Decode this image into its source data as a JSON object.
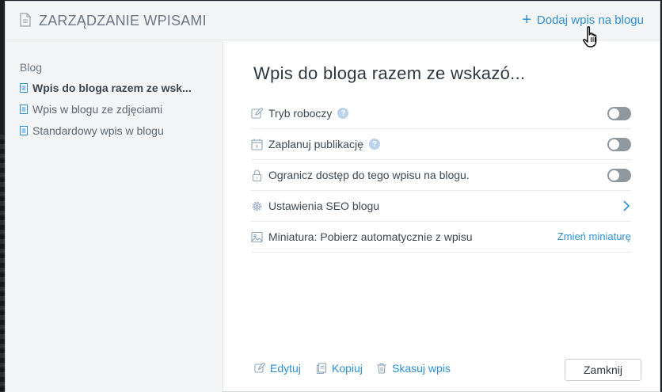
{
  "header": {
    "title": "ZARZĄDZANIE WPISAMI",
    "add_post_label": "Dodaj wpis na blogu",
    "add_post_icon": "plus-icon"
  },
  "sidebar": {
    "heading": "Blog",
    "items": [
      {
        "label": "Wpis do bloga razem ze wsk...",
        "active": true
      },
      {
        "label": "Wpis w blogu ze zdjęciami",
        "active": false
      },
      {
        "label": "Standardowy wpis w blogu",
        "active": false
      }
    ]
  },
  "main": {
    "title": "Wpis do bloga razem ze wskazó...",
    "rows": [
      {
        "label": "Tryb roboczy",
        "icon": "pencil-icon",
        "control": "toggle",
        "has_help": true,
        "on": false
      },
      {
        "label": "Zaplanuj publikację",
        "icon": "calendar-icon",
        "control": "toggle",
        "has_help": true,
        "on": false
      },
      {
        "label": "Ogranicz dostęp do tego wpisu na blogu.",
        "icon": "lock-icon",
        "control": "toggle",
        "has_help": false,
        "on": false
      },
      {
        "label": "Ustawienia SEO blogu",
        "icon": "gear-icon",
        "control": "chevron"
      },
      {
        "label_prefix": "Miniatura:",
        "label_value": "Pobierz automatycznie z wpisu",
        "icon": "image-icon",
        "control": "link",
        "link_label": "Zmień miniaturę"
      }
    ],
    "help_glyph": "?"
  },
  "footer": {
    "edit_label": "Edytuj",
    "copy_label": "Kopiuj",
    "delete_label": "Skasuj wpis",
    "close_label": "Zamknij"
  },
  "colors": {
    "accent": "#2b8fd6",
    "toggle_off": "#8f979f",
    "panel_bg": "#f4f5f6"
  }
}
